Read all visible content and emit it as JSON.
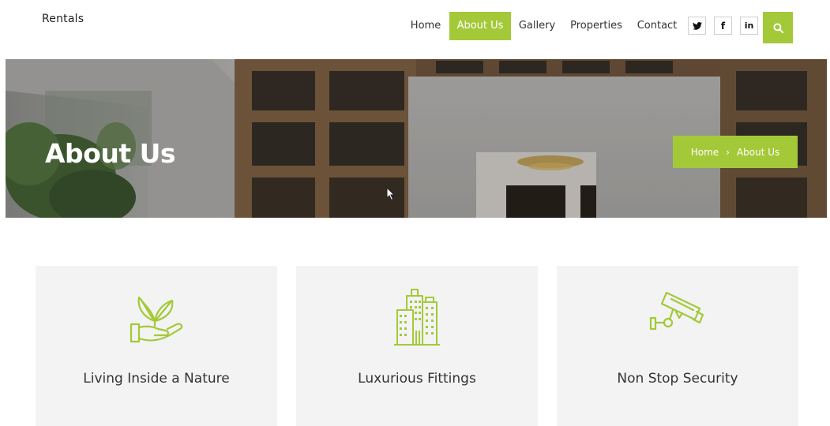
{
  "brand": {
    "name": "Rentals"
  },
  "nav": {
    "items": [
      {
        "label": "Home"
      },
      {
        "label": "About Us",
        "active": true
      },
      {
        "label": "Gallery"
      },
      {
        "label": "Properties"
      },
      {
        "label": "Contact"
      }
    ],
    "social": [
      {
        "label": "🐦︎",
        "icon": "twitter-icon"
      },
      {
        "label": "f",
        "icon": "facebook-icon"
      },
      {
        "label": "in",
        "icon": "linkedin-icon"
      }
    ],
    "search_icon": "search-icon"
  },
  "hero": {
    "title": "About Us",
    "breadcrumb": {
      "home": "Home",
      "separator": "›",
      "current": "About Us"
    }
  },
  "features": [
    {
      "label": "Living Inside a Nature",
      "icon": "plant-in-hand-icon"
    },
    {
      "label": "Luxurious Fittings",
      "icon": "buildings-icon"
    },
    {
      "label": "Non Stop Security",
      "icon": "security-camera-icon"
    }
  ],
  "colors": {
    "accent": "#a3c939",
    "card_bg": "#f3f3f3",
    "text": "#333333"
  }
}
